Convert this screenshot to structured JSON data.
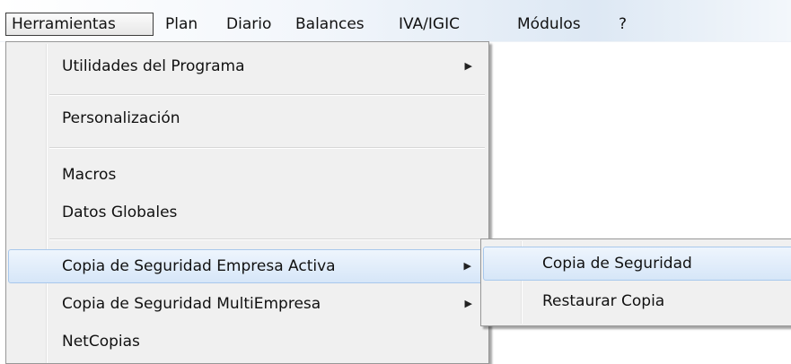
{
  "menubar": {
    "items": [
      {
        "label": "Herramientas"
      },
      {
        "label": "Plan"
      },
      {
        "label": "Diario"
      },
      {
        "label": "Balances"
      },
      {
        "label": "IVA/IGIC"
      },
      {
        "label": "Módulos"
      },
      {
        "label": "?"
      }
    ]
  },
  "dropdown": {
    "items": [
      {
        "label": "Utilidades del Programa",
        "has_submenu": true
      },
      {
        "label": "Personalización"
      },
      {
        "label": "Macros"
      },
      {
        "label": "Datos Globales"
      },
      {
        "label": "Copia de Seguridad Empresa Activa",
        "has_submenu": true,
        "highlighted": true
      },
      {
        "label": "Copia de Seguridad MultiEmpresa",
        "has_submenu": true
      },
      {
        "label": "NetCopias"
      }
    ],
    "arrow_glyph": "▶"
  },
  "submenu": {
    "items": [
      {
        "label": "Copia de Seguridad",
        "highlighted": true
      },
      {
        "label": "Restaurar Copia"
      }
    ]
  },
  "colors": {
    "menu_background": "#f0f0f0",
    "highlight": "#d6e6f8",
    "highlight_border": "#a8c8ec",
    "menubar_gradient_end": "#dde8f4"
  }
}
